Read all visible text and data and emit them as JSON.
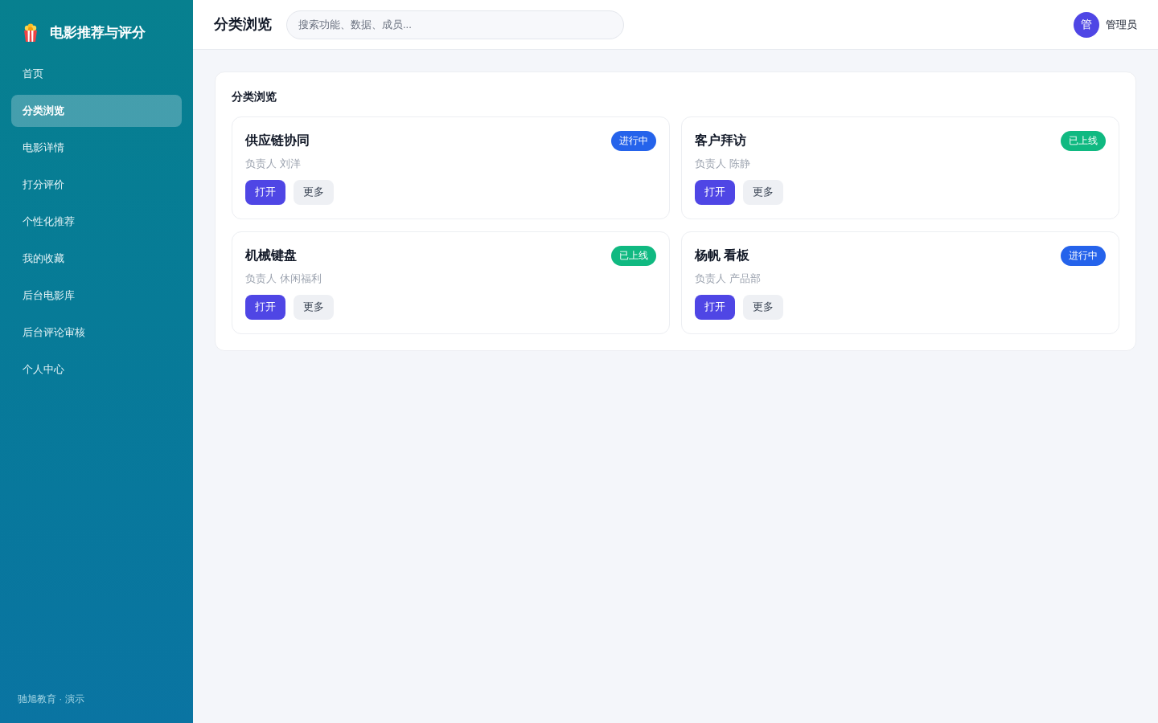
{
  "app": {
    "title": "电影推荐与评分"
  },
  "sidebar": {
    "items": [
      {
        "label": "首页",
        "selected": false
      },
      {
        "label": "分类浏览",
        "selected": true
      },
      {
        "label": "电影详情",
        "selected": false
      },
      {
        "label": "打分评价",
        "selected": false
      },
      {
        "label": "个性化推荐",
        "selected": false
      },
      {
        "label": "我的收藏",
        "selected": false
      },
      {
        "label": "后台电影库",
        "selected": false
      },
      {
        "label": "后台评论审核",
        "selected": false
      },
      {
        "label": "个人中心",
        "selected": false
      }
    ],
    "footer": "驰旭教育 · 演示"
  },
  "header": {
    "title": "分类浏览",
    "search": {
      "placeholder": "搜索功能、数据、成员..."
    },
    "user": {
      "avatar": "管",
      "name": "管理员"
    }
  },
  "panel": {
    "title": "分类浏览",
    "cards": [
      {
        "title": "供应链协同",
        "status": {
          "label": "进行中",
          "color": "#2563eb"
        },
        "owner": "负责人 刘洋",
        "actions": [
          {
            "label": "打开",
            "kind": "primary"
          },
          {
            "label": "更多",
            "kind": "secondary"
          }
        ]
      },
      {
        "title": "客户拜访",
        "status": {
          "label": "已上线",
          "color": "#10b981"
        },
        "owner": "负责人 陈静",
        "actions": [
          {
            "label": "打开",
            "kind": "primary"
          },
          {
            "label": "更多",
            "kind": "secondary"
          }
        ]
      },
      {
        "title": "机械键盘",
        "status": {
          "label": "已上线",
          "color": "#10b981"
        },
        "owner": "负责人 休闲福利",
        "actions": [
          {
            "label": "打开",
            "kind": "primary"
          },
          {
            "label": "更多",
            "kind": "secondary"
          }
        ]
      },
      {
        "title": "杨帆 看板",
        "status": {
          "label": "进行中",
          "color": "#2563eb"
        },
        "owner": "负责人 产品部",
        "actions": [
          {
            "label": "打开",
            "kind": "primary"
          },
          {
            "label": "更多",
            "kind": "secondary"
          }
        ]
      }
    ]
  }
}
